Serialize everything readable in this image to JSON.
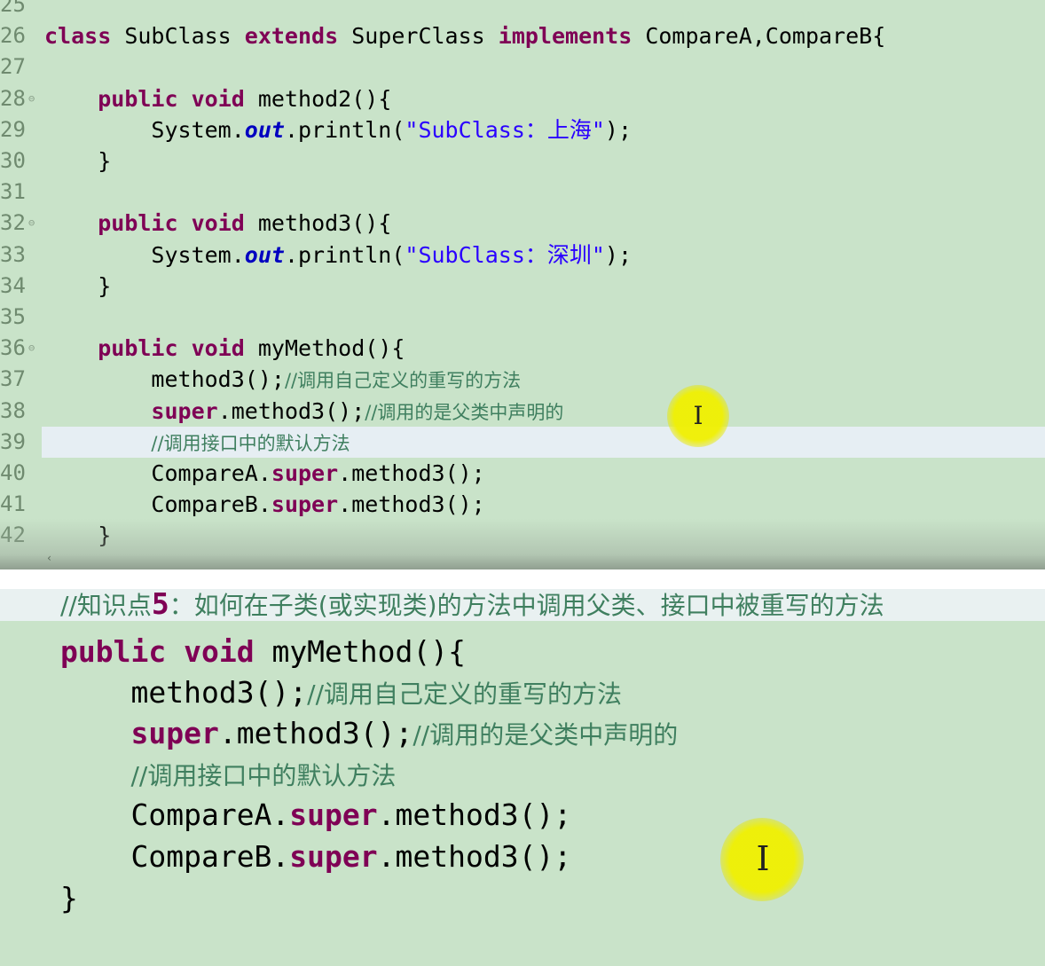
{
  "editor": {
    "lines": [
      {
        "num": "25",
        "fold": "",
        "indent": "",
        "parts": []
      },
      {
        "num": "26",
        "fold": "",
        "indent": "",
        "parts": [
          {
            "t": "class",
            "c": "kw"
          },
          {
            "t": " SubClass ",
            "c": ""
          },
          {
            "t": "extends",
            "c": "kw"
          },
          {
            "t": " SuperClass ",
            "c": ""
          },
          {
            "t": "implements",
            "c": "kw"
          },
          {
            "t": " CompareA,CompareB{",
            "c": ""
          }
        ]
      },
      {
        "num": "27",
        "fold": "",
        "indent": "",
        "parts": []
      },
      {
        "num": "28",
        "fold": "⊖",
        "indent": "    ",
        "parts": [
          {
            "t": "public",
            "c": "kw"
          },
          {
            "t": " ",
            "c": ""
          },
          {
            "t": "void",
            "c": "kw"
          },
          {
            "t": " method2(){",
            "c": ""
          }
        ]
      },
      {
        "num": "29",
        "fold": "",
        "indent": "        ",
        "parts": [
          {
            "t": "System.",
            "c": ""
          },
          {
            "t": "out",
            "c": "field"
          },
          {
            "t": ".println(",
            "c": ""
          },
          {
            "t": "\"SubClass：上海\"",
            "c": "str"
          },
          {
            "t": ");",
            "c": ""
          }
        ]
      },
      {
        "num": "30",
        "fold": "",
        "indent": "    ",
        "parts": [
          {
            "t": "}",
            "c": ""
          }
        ]
      },
      {
        "num": "31",
        "fold": "",
        "indent": "",
        "parts": []
      },
      {
        "num": "32",
        "fold": "⊖",
        "indent": "    ",
        "parts": [
          {
            "t": "public",
            "c": "kw"
          },
          {
            "t": " ",
            "c": ""
          },
          {
            "t": "void",
            "c": "kw"
          },
          {
            "t": " method3(){",
            "c": ""
          }
        ]
      },
      {
        "num": "33",
        "fold": "",
        "indent": "        ",
        "parts": [
          {
            "t": "System.",
            "c": ""
          },
          {
            "t": "out",
            "c": "field"
          },
          {
            "t": ".println(",
            "c": ""
          },
          {
            "t": "\"SubClass：深圳\"",
            "c": "str"
          },
          {
            "t": ");",
            "c": ""
          }
        ]
      },
      {
        "num": "34",
        "fold": "",
        "indent": "    ",
        "parts": [
          {
            "t": "}",
            "c": ""
          }
        ]
      },
      {
        "num": "35",
        "fold": "",
        "indent": "",
        "parts": []
      },
      {
        "num": "36",
        "fold": "⊖",
        "indent": "    ",
        "parts": [
          {
            "t": "public",
            "c": "kw"
          },
          {
            "t": " ",
            "c": ""
          },
          {
            "t": "void",
            "c": "kw"
          },
          {
            "t": " myMethod(){",
            "c": ""
          }
        ]
      },
      {
        "num": "37",
        "fold": "",
        "indent": "        ",
        "parts": [
          {
            "t": "method3();",
            "c": ""
          },
          {
            "t": "//调用自己定义的重写的方法",
            "c": "cmt"
          }
        ]
      },
      {
        "num": "38",
        "fold": "",
        "indent": "        ",
        "parts": [
          {
            "t": "super",
            "c": "kw"
          },
          {
            "t": ".method3();",
            "c": ""
          },
          {
            "t": "//调用的是父类中声明的",
            "c": "cmt"
          }
        ]
      },
      {
        "num": "39",
        "fold": "",
        "indent": "        ",
        "parts": [
          {
            "t": "//调用接口中的默认方法",
            "c": "cmt"
          }
        ]
      },
      {
        "num": "40",
        "fold": "",
        "indent": "        ",
        "parts": [
          {
            "t": "CompareA.",
            "c": ""
          },
          {
            "t": "super",
            "c": "kw"
          },
          {
            "t": ".method3();",
            "c": ""
          }
        ]
      },
      {
        "num": "41",
        "fold": "",
        "indent": "        ",
        "parts": [
          {
            "t": "CompareB.",
            "c": ""
          },
          {
            "t": "super",
            "c": "kw"
          },
          {
            "t": ".method3();",
            "c": ""
          }
        ]
      },
      {
        "num": "42",
        "fold": "",
        "indent": "    ",
        "parts": [
          {
            "t": "}",
            "c": ""
          }
        ]
      }
    ],
    "scroll_arrow": "‹",
    "cursor_glyph": "I"
  },
  "slide": {
    "lines": [
      {
        "indent": "",
        "parts": [
          {
            "t": "//知识点",
            "c": "s-cmt"
          },
          {
            "t": "5",
            "c": "s-num"
          },
          {
            "t": "：如何在子类(或实现类)的方法中调用父类、接口中被重写的方法",
            "c": "s-cmt"
          }
        ]
      },
      {
        "indent": "",
        "parts": [
          {
            "t": "public",
            "c": "s-kw"
          },
          {
            "t": " ",
            "c": ""
          },
          {
            "t": "void",
            "c": "s-kw"
          },
          {
            "t": " myMethod(){",
            "c": ""
          }
        ]
      },
      {
        "indent": "    ",
        "parts": [
          {
            "t": "method3();",
            "c": ""
          },
          {
            "t": "//调用自己定义的重写的方法",
            "c": "s-cmt"
          }
        ]
      },
      {
        "indent": "    ",
        "parts": [
          {
            "t": "super",
            "c": "s-kw"
          },
          {
            "t": ".method3();",
            "c": ""
          },
          {
            "t": "//调用的是父类中声明的",
            "c": "s-cmt"
          }
        ]
      },
      {
        "indent": "    ",
        "parts": [
          {
            "t": "//调用接口中的默认方法",
            "c": "s-cmt"
          }
        ]
      },
      {
        "indent": "    ",
        "parts": [
          {
            "t": "CompareA.",
            "c": ""
          },
          {
            "t": "super",
            "c": "s-kw"
          },
          {
            "t": ".method3();",
            "c": ""
          }
        ]
      },
      {
        "indent": "    ",
        "parts": [
          {
            "t": "CompareB.",
            "c": ""
          },
          {
            "t": "super",
            "c": "s-kw"
          },
          {
            "t": ".method3();",
            "c": ""
          }
        ]
      },
      {
        "indent": "",
        "parts": [
          {
            "t": "}",
            "c": ""
          }
        ]
      }
    ],
    "cursor_glyph": "I"
  }
}
